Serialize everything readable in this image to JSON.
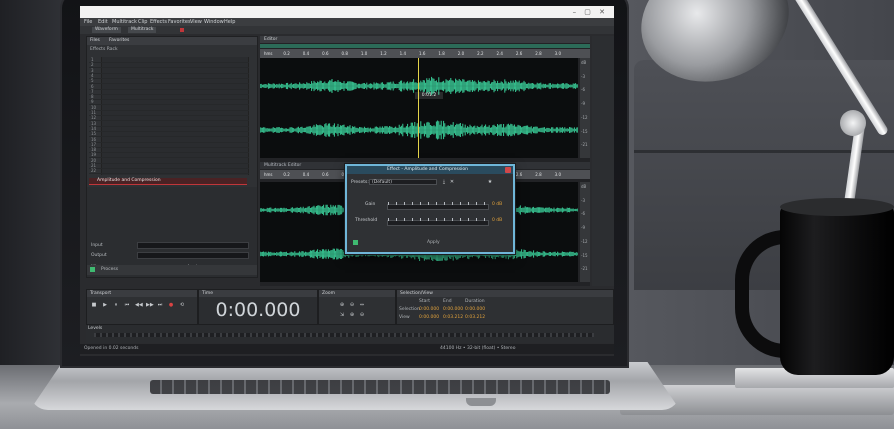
{
  "window": {
    "menus": [
      "File",
      "Edit",
      "Multitrack",
      "Clip",
      "Effects",
      "Favorites",
      "View",
      "Window",
      "Help"
    ],
    "controls": "–  ▢  ✕",
    "toolbar_tabs": [
      "Waveform",
      "Multitrack"
    ]
  },
  "left_panel": {
    "tabs": [
      "Files",
      "Favorites"
    ],
    "subtitle": "Effects Rack",
    "row_numbers": [
      "1",
      "2",
      "3",
      "4",
      "5",
      "6",
      "7",
      "8",
      "9",
      "10",
      "11",
      "12",
      "13",
      "14",
      "15",
      "16",
      "17",
      "18",
      "19",
      "20",
      "21",
      "22"
    ],
    "selected_row": "Amplitude and Compression",
    "mix_label": "Mix",
    "input_label": "Input",
    "output_label": "Output",
    "apply_label": "Apply",
    "footer_label": "Process"
  },
  "editor": {
    "tab_label": "Editor",
    "ruler_ticks": [
      "hms",
      "0.2",
      "0.4",
      "0.6",
      "0.8",
      "1.0",
      "1.2",
      "1.4",
      "1.6",
      "1.8",
      "2.0",
      "2.2",
      "2.4",
      "2.6",
      "2.8",
      "3.0"
    ],
    "timecode": "0:01.2",
    "lower_title": "Multitrack Editor",
    "scale_labels": [
      "dB",
      "-3",
      "-6",
      "-9",
      "-12",
      "-15",
      "-21"
    ]
  },
  "dialog": {
    "title": "Effect - Amplitude and Compression",
    "presets_label": "Presets:",
    "preset_value": "(Default)",
    "gain_label": "Gain",
    "threshold_label": "Threshold",
    "gain_value": "0 dB",
    "threshold_value": "0 dB",
    "footer": "Apply"
  },
  "transport": {
    "title": "Transport",
    "buttons": [
      "■",
      "▶",
      "⏸",
      "⏮",
      "◀◀",
      "▶▶",
      "⏭",
      "●",
      "⟲"
    ]
  },
  "time": {
    "title": "Time",
    "value": "0:00.000"
  },
  "zoom": {
    "title": "Zoom",
    "buttons": [
      "⊕",
      "⊖",
      "⇔",
      "⇲",
      "⊕",
      "⊖"
    ]
  },
  "selection": {
    "title": "Selection/View",
    "headers": [
      "Start",
      "End",
      "Duration"
    ],
    "rows": [
      {
        "label": "Selection",
        "values": [
          "0:00.000",
          "0:00.000",
          "0:00.000"
        ]
      },
      {
        "label": "View",
        "values": [
          "0:00.000",
          "0:03.212",
          "0:03.212"
        ]
      }
    ]
  },
  "levels": {
    "title": "Levels"
  },
  "status": {
    "left": "Opened in 0.02 seconds",
    "right": "44100 Hz • 32-bit (float) • Stereo"
  }
}
